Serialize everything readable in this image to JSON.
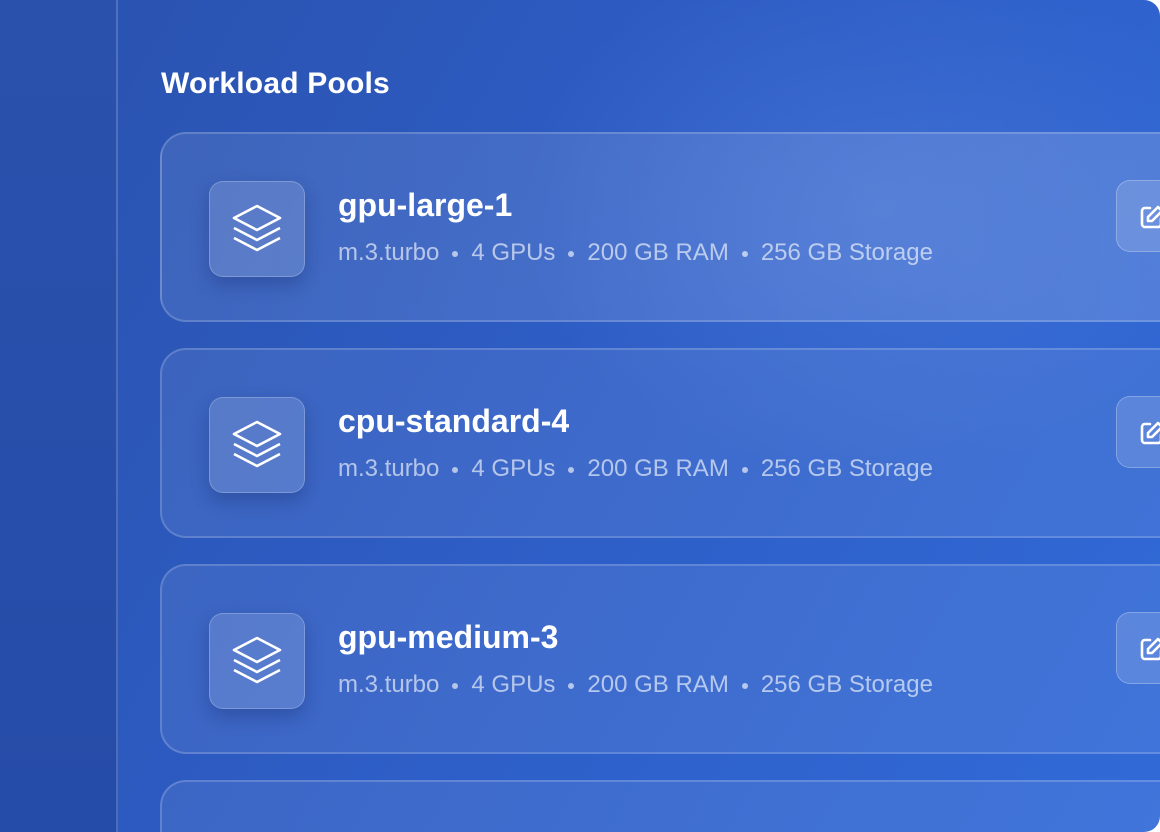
{
  "header": {
    "title": "Workload Pools"
  },
  "pools": [
    {
      "name": "gpu-large-1",
      "instance": "m.3.turbo",
      "gpus": "4 GPUs",
      "ram": "200 GB RAM",
      "storage": "256 GB Storage",
      "icon": "layers-icon",
      "action_icon": "edit-icon"
    },
    {
      "name": "cpu-standard-4",
      "instance": "m.3.turbo",
      "gpus": "4 GPUs",
      "ram": "200 GB RAM",
      "storage": "256 GB Storage",
      "icon": "layers-icon",
      "action_icon": "edit-icon"
    },
    {
      "name": "gpu-medium-3",
      "instance": "m.3.turbo",
      "gpus": "4 GPUs",
      "ram": "200 GB RAM",
      "storage": "256 GB Storage",
      "icon": "layers-icon",
      "action_icon": "edit-icon"
    }
  ],
  "colors": {
    "background_start": "#2a52ad",
    "background_end": "#316ad8",
    "text_primary": "#ffffff"
  }
}
